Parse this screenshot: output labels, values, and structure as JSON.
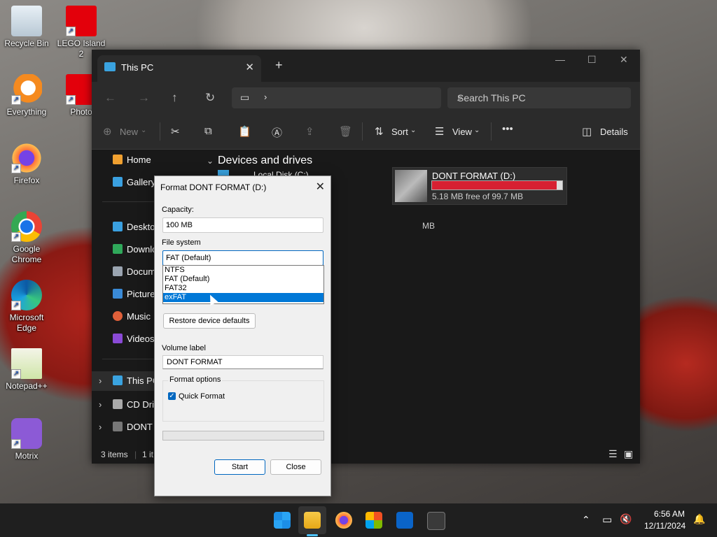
{
  "desktop": {
    "icons": [
      {
        "label": "Recycle Bin"
      },
      {
        "label": "LEGO Island 2"
      },
      {
        "label": "Everything"
      },
      {
        "label": "Photo"
      },
      {
        "label": "Firefox"
      },
      {
        "label": "Google Chrome"
      },
      {
        "label": "Microsoft Edge"
      },
      {
        "label": "Notepad++"
      },
      {
        "label": "Motrix"
      }
    ]
  },
  "explorer": {
    "tab_title": "This PC",
    "search_placeholder": "Search This PC",
    "toolbar": {
      "new_label": "New",
      "sort_label": "Sort",
      "view_label": "View",
      "details_label": "Details"
    },
    "sidebar": {
      "items": [
        "Home",
        "Gallery",
        "Desktop",
        "Downloads",
        "Documents",
        "Pictures",
        "Music",
        "Videos"
      ],
      "tree": [
        "This PC",
        "CD Drive",
        "DONT FORMAT"
      ]
    },
    "section_title": "Devices and drives",
    "drives": [
      {
        "name": "Local Disk (C:)",
        "free_text": "MB"
      },
      {
        "name": "",
        "free_text": "MB"
      },
      {
        "name": "DONT FORMAT (D:)",
        "free_text": "5.18 MB free of 99.7 MB",
        "used_fraction": 0.95
      }
    ],
    "status": {
      "items": "3 items",
      "selected": "1 it"
    }
  },
  "format_dialog": {
    "title": "Format DONT FORMAT (D:)",
    "capacity_label": "Capacity:",
    "capacity_value": "100 MB",
    "filesystem_label": "File system",
    "filesystem_value": "FAT (Default)",
    "filesystem_options": [
      "NTFS",
      "FAT (Default)",
      "FAT32",
      "exFAT"
    ],
    "highlighted_option": "exFAT",
    "restore_label": "Restore device defaults",
    "volume_label_label": "Volume label",
    "volume_label_value": "DONT FORMAT",
    "format_options_label": "Format options",
    "quick_format_label": "Quick Format",
    "quick_format_checked": true,
    "start_label": "Start",
    "close_label": "Close"
  },
  "taskbar": {
    "time": "6:56 AM",
    "date": "12/11/2024"
  },
  "colors": {
    "accent": "#0078d7",
    "drive_bar_full": "#d72032",
    "explorer_bg": "#191919"
  }
}
